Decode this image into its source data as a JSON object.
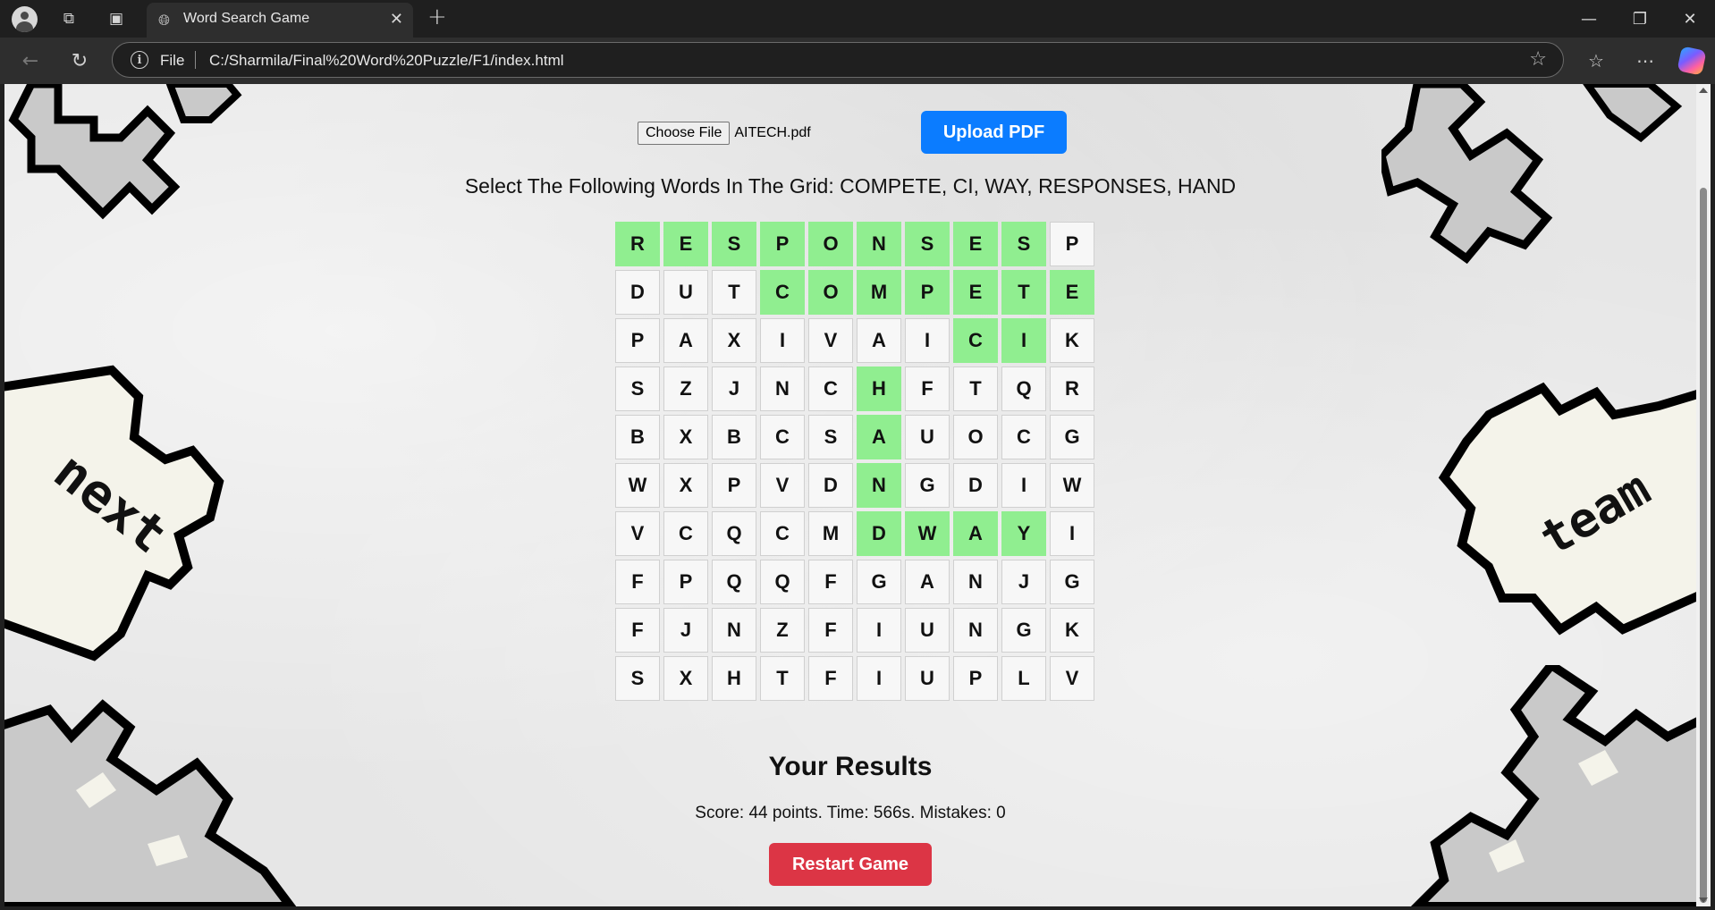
{
  "browser": {
    "tab_title": "Word Search Game",
    "url_scheme": "File",
    "url": "C:/Sharmila/Final%20Word%20Puzzle/F1/index.html"
  },
  "page": {
    "choose_file_label": "Choose File",
    "file_name": "AITECH.pdf",
    "upload_label": "Upload PDF",
    "instruction": "Select The Following Words In The Grid: COMPETE, CI, WAY, RESPONSES, HAND",
    "results_title": "Your Results",
    "results_text": "Score: 44 points. Time: 566s. Mistakes: 0",
    "restart_label": "Restart Game",
    "decor_left_text": "next",
    "decor_right_text": "team"
  },
  "grid": {
    "rows": [
      [
        "R",
        "E",
        "S",
        "P",
        "O",
        "N",
        "S",
        "E",
        "S",
        "P"
      ],
      [
        "D",
        "U",
        "T",
        "C",
        "O",
        "M",
        "P",
        "E",
        "T",
        "E"
      ],
      [
        "P",
        "A",
        "X",
        "I",
        "V",
        "A",
        "I",
        "C",
        "I",
        "K"
      ],
      [
        "S",
        "Z",
        "J",
        "N",
        "C",
        "H",
        "F",
        "T",
        "Q",
        "R"
      ],
      [
        "B",
        "X",
        "B",
        "C",
        "S",
        "A",
        "U",
        "O",
        "C",
        "G"
      ],
      [
        "W",
        "X",
        "P",
        "V",
        "D",
        "N",
        "G",
        "D",
        "I",
        "W"
      ],
      [
        "V",
        "C",
        "Q",
        "C",
        "M",
        "D",
        "W",
        "A",
        "Y",
        "I"
      ],
      [
        "F",
        "P",
        "Q",
        "Q",
        "F",
        "G",
        "A",
        "N",
        "J",
        "G"
      ],
      [
        "F",
        "J",
        "N",
        "Z",
        "F",
        "I",
        "U",
        "N",
        "G",
        "K"
      ],
      [
        "S",
        "X",
        "H",
        "T",
        "F",
        "I",
        "U",
        "P",
        "L",
        "V"
      ]
    ],
    "found": [
      [
        1,
        1,
        1,
        1,
        1,
        1,
        1,
        1,
        1,
        0
      ],
      [
        0,
        0,
        0,
        1,
        1,
        1,
        1,
        1,
        1,
        1
      ],
      [
        0,
        0,
        0,
        0,
        0,
        0,
        0,
        1,
        1,
        0
      ],
      [
        0,
        0,
        0,
        0,
        0,
        1,
        0,
        0,
        0,
        0
      ],
      [
        0,
        0,
        0,
        0,
        0,
        1,
        0,
        0,
        0,
        0
      ],
      [
        0,
        0,
        0,
        0,
        0,
        1,
        0,
        0,
        0,
        0
      ],
      [
        0,
        0,
        0,
        0,
        0,
        1,
        1,
        1,
        1,
        0
      ],
      [
        0,
        0,
        0,
        0,
        0,
        0,
        0,
        0,
        0,
        0
      ],
      [
        0,
        0,
        0,
        0,
        0,
        0,
        0,
        0,
        0,
        0
      ],
      [
        0,
        0,
        0,
        0,
        0,
        0,
        0,
        0,
        0,
        0
      ]
    ]
  },
  "colors": {
    "found_cell": "#90ee90",
    "upload_button": "#0b7cff",
    "restart_button": "#dc3545"
  }
}
